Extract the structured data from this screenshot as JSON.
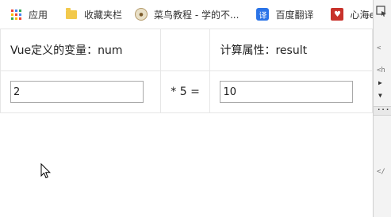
{
  "bookmarks": [
    {
      "label": "应用",
      "icon": "apps-icon"
    },
    {
      "label": "收藏夹栏",
      "icon": "folder-icon"
    },
    {
      "label": "菜鸟教程 - 学的不...",
      "icon": "runoob-icon"
    },
    {
      "label": "百度翻译",
      "icon": "baidu-translate-icon"
    },
    {
      "label": "心海e站-点",
      "icon": "xinhai-icon"
    }
  ],
  "table": {
    "header_left": "Vue定义的变量：num",
    "header_right": "计算属性：result",
    "operator": "* 5 =",
    "num_value": "2",
    "result_value": "10"
  },
  "devtools": {
    "lines": [
      "<",
      "<h",
      "▶",
      "▼",
      "...",
      "</"
    ]
  },
  "colors": {
    "apps_dots": [
      "#ea4335",
      "#4285f4",
      "#34a853",
      "#fbbc05",
      "#ea4335",
      "#4285f4",
      "#34a853",
      "#fbbc05",
      "#ea4335"
    ]
  }
}
